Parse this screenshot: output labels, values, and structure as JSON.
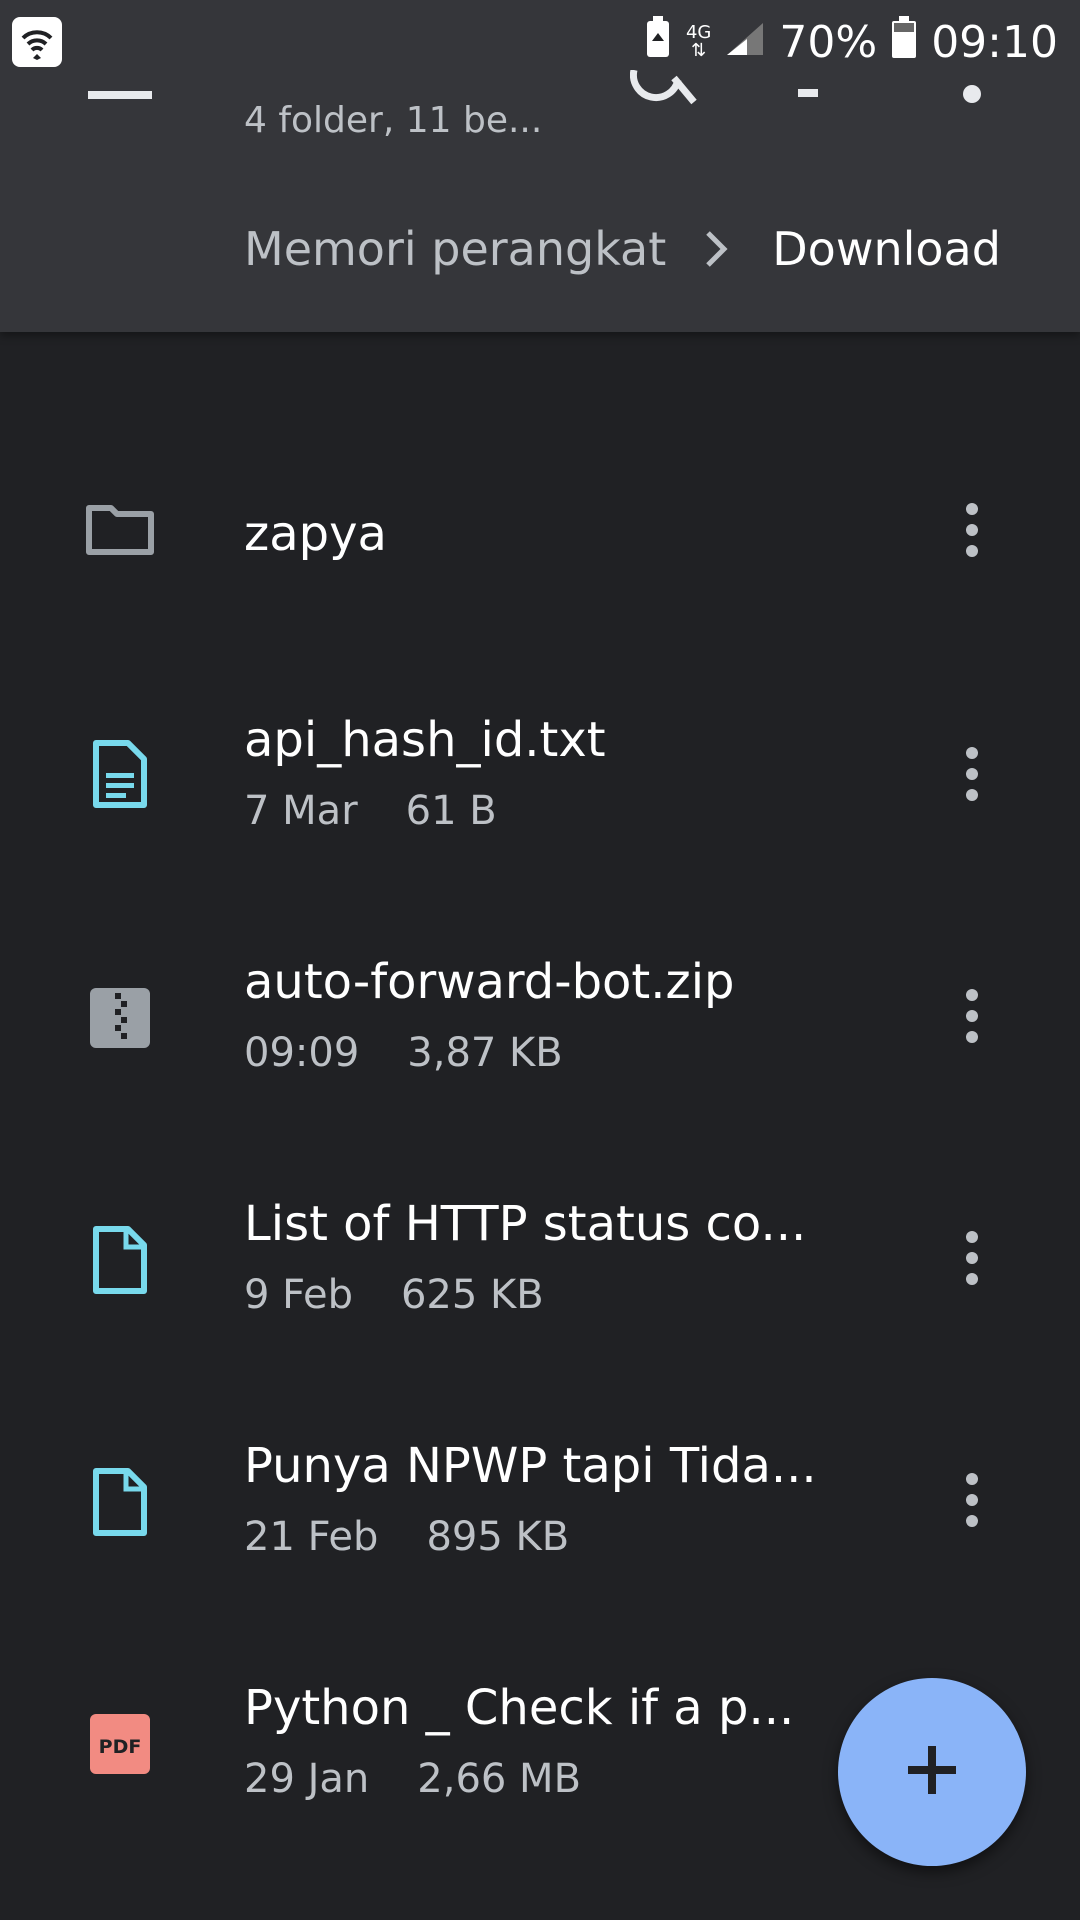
{
  "status_bar": {
    "network_type": "4G",
    "battery_percent": "70%",
    "time": "09:10"
  },
  "header": {
    "subtitle": "4 folder, 11 be...",
    "breadcrumb": {
      "root": "Memori perangkat",
      "current": "Download"
    }
  },
  "files": [
    {
      "name": "zapya",
      "type": "folder",
      "date": "",
      "size": "",
      "icon": "folder-icon"
    },
    {
      "name": "api_hash_id.txt",
      "type": "text",
      "date": "7 Mar",
      "size": "61 B",
      "icon": "text-file-icon"
    },
    {
      "name": "auto-forward-bot.zip",
      "type": "zip",
      "date": "09:09",
      "size": "3,87 KB",
      "icon": "zip-file-icon"
    },
    {
      "name": "List of HTTP status co...",
      "type": "document",
      "date": "9 Feb",
      "size": "625 KB",
      "icon": "file-icon"
    },
    {
      "name": "Punya NPWP tapi Tida...",
      "type": "document",
      "date": "21 Feb",
      "size": "895 KB",
      "icon": "file-icon"
    },
    {
      "name": "Python _ Check if a p...",
      "type": "pdf",
      "date": "29 Jan",
      "size": "2,66 MB",
      "icon": "pdf-file-icon",
      "badge": "PDF"
    }
  ],
  "fab": {
    "label": "+"
  },
  "colors": {
    "background": "#202124",
    "header": "#35363a",
    "accent": "#8ab4f8",
    "file_icon": "#78d9ec",
    "pdf_icon": "#f28b82"
  }
}
